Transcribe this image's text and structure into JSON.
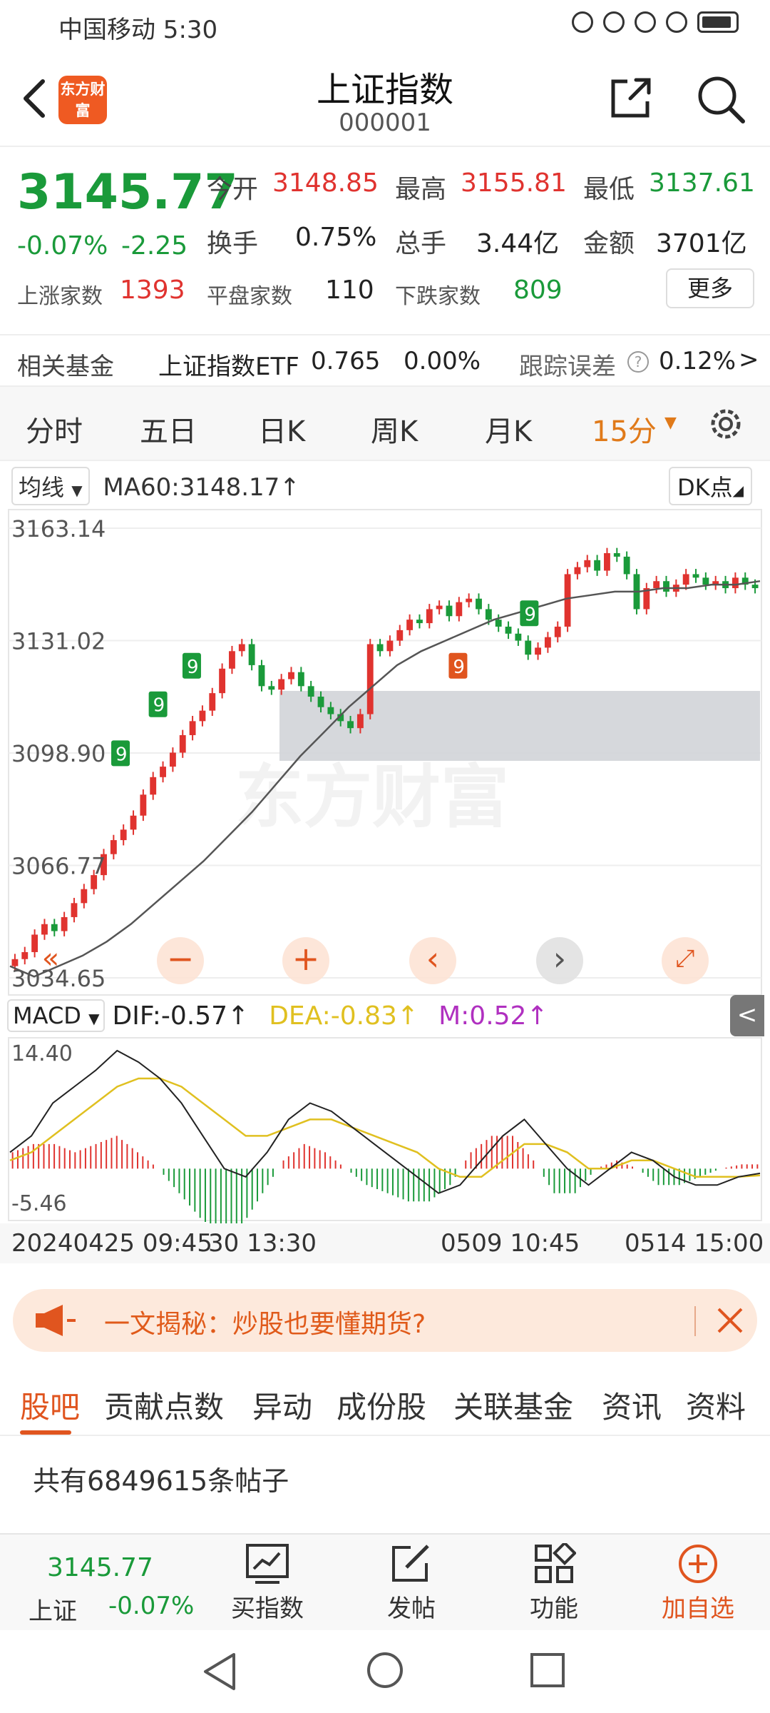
{
  "status_bar": {
    "carrier_time": "中国移动 5:30"
  },
  "header": {
    "logo_text": "东方财富",
    "title": "上证指数",
    "code": "000001"
  },
  "quote": {
    "price": "3145.77",
    "change_pct": "-0.07%",
    "change_abs": "-2.25",
    "open_label": "今开",
    "open": "3148.85",
    "high_label": "最高",
    "high": "3155.81",
    "low_label": "最低",
    "low": "3137.61",
    "turnover_label": "换手",
    "turnover": "0.75%",
    "volume_label": "总手",
    "volume": "3.44亿",
    "amount_label": "金额",
    "amount": "3701亿",
    "up_label": "上涨家数",
    "up": "1393",
    "flat_label": "平盘家数",
    "flat": "110",
    "down_label": "下跌家数",
    "down": "809",
    "more_label": "更多"
  },
  "fund_row": {
    "label": "相关基金",
    "fund_name": "上证指数ETF",
    "fund_price": "0.765",
    "fund_change": "0.00%",
    "tracking_label": "跟踪误差",
    "tracking_value": "0.12%",
    "arrow": ">"
  },
  "period_tabs": [
    "分时",
    "五日",
    "日K",
    "周K",
    "月K",
    "15分"
  ],
  "chart_controls": {
    "ma_button": "均线",
    "ma_text": "MA60:3148.17↑",
    "dk_button": "DK点",
    "macd_button": "MACD",
    "dif_text": "DIF:-0.57↑",
    "dea_text": "DEA:-0.83↑",
    "m_text": "M:0.52↑",
    "watermark": "东方财富",
    "collapse_arrow": "<"
  },
  "colors": {
    "up": "#e0332f",
    "down": "#1a9a3a",
    "accent": "#e0551f",
    "dea": "#e0c020",
    "m": "#b030c0"
  },
  "chart_data": [
    {
      "type": "candlestick",
      "ylim": [
        3034.65,
        3163.14
      ],
      "y_tick_labels": [
        "3163.14",
        "3131.02",
        "3098.90",
        "3066.77",
        "3034.65"
      ],
      "x_tick_labels": [
        "20240425 09:45",
        "30 13:30",
        "0509 10:45",
        "0514 15:00"
      ],
      "series": [
        {
          "values": [
            3040,
            3042,
            3047,
            3050,
            3048,
            3052,
            3056,
            3060,
            3064,
            3070,
            3074,
            3077,
            3081,
            3087,
            3092,
            3095,
            3099,
            3104,
            3108,
            3111,
            3116,
            3123,
            3128,
            3130,
            3124,
            3118,
            3117,
            3120,
            3122,
            3118,
            3115,
            3112,
            3110,
            3108,
            3106,
            3110,
            3130,
            3128,
            3131,
            3134,
            3137,
            3136,
            3140,
            3141,
            3138,
            3142,
            3143,
            3140,
            3137,
            3135,
            3133,
            3131,
            3127,
            3129,
            3132,
            3135,
            3150,
            3152,
            3154,
            3151,
            3156,
            3155,
            3150,
            3140,
            3146,
            3148,
            3145,
            3147,
            3150,
            3149,
            3147,
            3148,
            3146,
            3149,
            3147,
            3146
          ]
        },
        {
          "name": "MA60",
          "values": [
            3038,
            3035,
            3038,
            3041,
            3045,
            3050,
            3056,
            3062,
            3068,
            3075,
            3082,
            3090,
            3098,
            3105,
            3112,
            3118,
            3124,
            3128,
            3131,
            3134,
            3137,
            3139,
            3141,
            3143,
            3144,
            3145,
            3145,
            3146,
            3146,
            3147,
            3147,
            3148
          ]
        }
      ]
    },
    {
      "type": "line",
      "ylim": [
        -5.46,
        14.4
      ],
      "y_tick_labels": [
        "14.40",
        "-5.46"
      ],
      "series": [
        {
          "name": "DIF",
          "values": [
            2,
            4,
            8,
            10,
            12,
            14.4,
            13,
            11,
            8,
            4,
            0,
            -1,
            2,
            6,
            8,
            7,
            5,
            3,
            1,
            -1,
            -3,
            -2,
            1,
            4,
            6,
            3,
            0,
            -2,
            0,
            2,
            1,
            -1,
            -2,
            -2,
            -1,
            -0.57
          ]
        },
        {
          "name": "DEA",
          "values": [
            1,
            2,
            4,
            6,
            8,
            10,
            11,
            11,
            10,
            8,
            6,
            4,
            4,
            5,
            6,
            6,
            5,
            4,
            3,
            2,
            0,
            -1,
            -1,
            1,
            3,
            3,
            2,
            0,
            0,
            1,
            1,
            0,
            -1,
            -1,
            -1,
            -0.83
          ]
        },
        {
          "name": "M",
          "values": [
            2,
            3,
            3,
            2,
            3,
            4,
            2,
            0,
            -3,
            -6,
            -8,
            -7,
            -3,
            1,
            3,
            2,
            0,
            -2,
            -3,
            -4,
            -4,
            -2,
            2,
            4,
            4,
            1,
            -3,
            -3,
            0,
            1,
            0,
            -2,
            -2,
            -1,
            0,
            0.52
          ]
        }
      ]
    }
  ],
  "ad_banner": {
    "text": "一文揭秘：炒股也要懂期货?"
  },
  "content_tabs": [
    "股吧",
    "贡献点数",
    "异动",
    "成份股",
    "关联基金",
    "资讯",
    "资料"
  ],
  "post_count": "共有6849615条帖子",
  "toolbar": {
    "price": "3145.77",
    "label": "上证",
    "change": "-0.07%",
    "items": [
      "买指数",
      "发帖",
      "功能",
      "加自选"
    ]
  }
}
